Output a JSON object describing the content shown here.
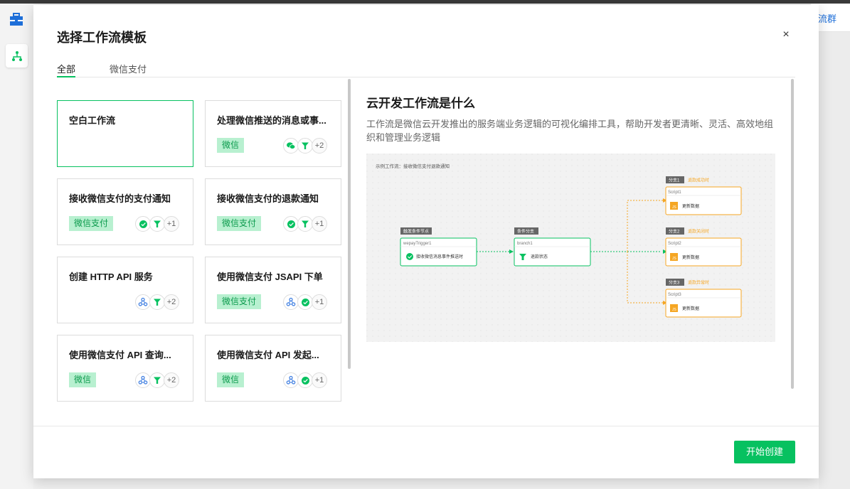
{
  "background": {
    "link_text": "流群"
  },
  "modal": {
    "title": "选择工作流模板",
    "close_symbol": "×",
    "tabs": [
      {
        "label": "全部",
        "active": true
      },
      {
        "label": "微信支付",
        "active": false
      }
    ],
    "templates": [
      {
        "title": "空白工作流",
        "tag": "",
        "icons": [],
        "more": "",
        "selected": true
      },
      {
        "title": "处理微信推送的消息或事...",
        "tag": "微信",
        "icons": [
          "wechat-icon",
          "filter-icon"
        ],
        "more": "+2",
        "selected": false
      },
      {
        "title": "接收微信支付的支付通知",
        "tag": "微信支付",
        "icons": [
          "wechat-pay-icon",
          "filter-icon"
        ],
        "more": "+1",
        "selected": false
      },
      {
        "title": "接收微信支付的退款通知",
        "tag": "微信支付",
        "icons": [
          "wechat-pay-icon",
          "filter-icon"
        ],
        "more": "+1",
        "selected": false
      },
      {
        "title": "创建 HTTP API 服务",
        "tag": "",
        "icons": [
          "webhook-icon",
          "filter-icon"
        ],
        "more": "+2",
        "selected": false
      },
      {
        "title": "使用微信支付 JSAPI 下单",
        "tag": "微信支付",
        "icons": [
          "webhook-icon",
          "wechat-pay-icon"
        ],
        "more": "+1",
        "selected": false
      },
      {
        "title": "使用微信支付 API 查询...",
        "tag": "微信",
        "icons": [
          "webhook-icon",
          "filter-icon"
        ],
        "more": "+2",
        "selected": false
      },
      {
        "title": "使用微信支付 API 发起...",
        "tag": "微信",
        "icons": [
          "webhook-icon",
          "wechat-pay-icon"
        ],
        "more": "+1",
        "selected": false
      }
    ],
    "info": {
      "title": "云开发工作流是什么",
      "description": "工作流是微信云开发推出的服务端业务逻辑的可视化编排工具，帮助开发者更清晰、灵活、高效地组织和管理业务逻辑"
    },
    "diagram": {
      "caption": "示例工作流：接收微信支付退款通知",
      "trigger": {
        "tag": "触发条件节点",
        "name": "wepayTrigger1",
        "body": "接收微信消息事件推送时"
      },
      "branch": {
        "tag": "条件分支",
        "name": "branch1",
        "body": "退款状态"
      },
      "outputs": [
        {
          "tag": "分支1",
          "status": "退款成功时",
          "name": "Script1",
          "body": "更新数据"
        },
        {
          "tag": "分支2",
          "status": "退款关闭时",
          "name": "Script2",
          "body": "更新数据"
        },
        {
          "tag": "分支3",
          "status": "退款异常时",
          "name": "Script3",
          "body": "更新数据"
        }
      ],
      "js_label": "JS"
    },
    "create_button": "开始创建"
  },
  "colors": {
    "accent": "#07c160",
    "tag_bg": "#b8f0d0",
    "script_orange": "#f5a623",
    "link_blue": "#1e6fd9"
  }
}
